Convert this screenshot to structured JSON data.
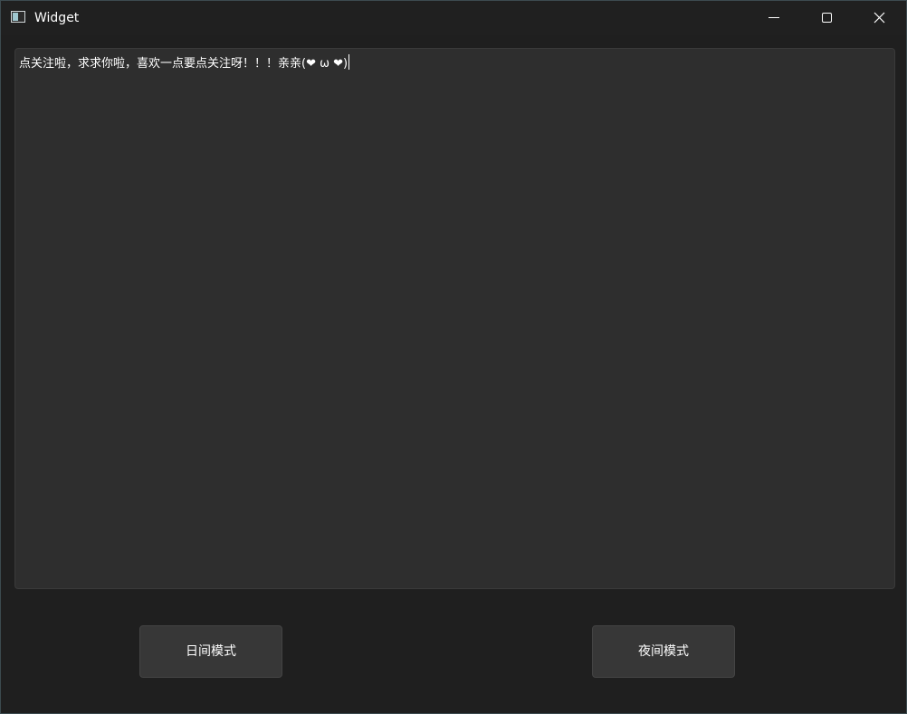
{
  "window": {
    "title": "Widget",
    "app_icon": "window-app-icon",
    "controls": {
      "minimize_icon": "minimize-icon",
      "maximize_icon": "maximize-icon",
      "close_icon": "close-icon"
    }
  },
  "editor": {
    "text": "点关注啦，求求你啦，喜欢一点要点关注呀！！！亲亲(❤ ω ❤)"
  },
  "buttons": {
    "day_mode_label": "日间模式",
    "night_mode_label": "夜间模式"
  },
  "colors": {
    "window_bg": "#1f1f1f",
    "editor_bg": "#2e2e2e",
    "button_bg": "#373737",
    "text": "#ffffff"
  }
}
